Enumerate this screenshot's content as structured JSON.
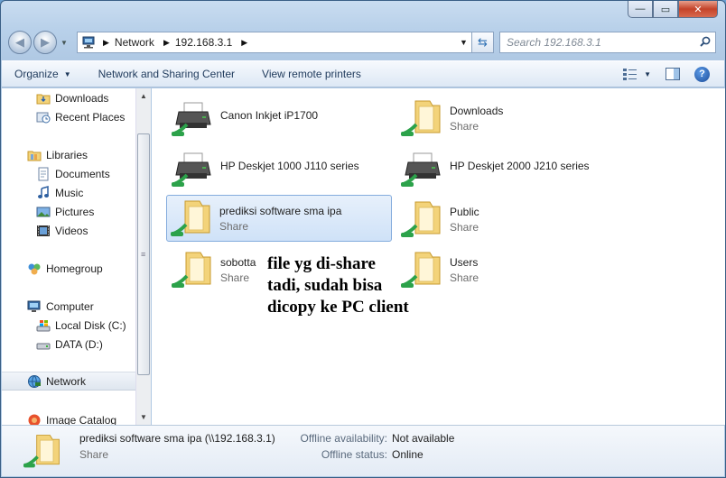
{
  "window": {
    "minimize_glyph": "—",
    "maximize_glyph": "▭",
    "close_glyph": "✕"
  },
  "nav": {
    "back_glyph": "◀",
    "forward_glyph": "▶",
    "dropdown_glyph": "▼",
    "breadcrumb": [
      "Network",
      "192.168.3.1"
    ],
    "search_placeholder": "Search 192.168.3.1"
  },
  "toolbar": {
    "organize": "Organize",
    "network_sharing": "Network and Sharing Center",
    "remote_printers": "View remote printers"
  },
  "sidebar": {
    "items": [
      {
        "label": "Downloads",
        "icon": "folder-icon"
      },
      {
        "label": "Recent Places",
        "icon": "recent-places-icon"
      },
      {
        "label": "Libraries",
        "icon": "libraries-icon"
      },
      {
        "label": "Documents",
        "icon": "documents-icon"
      },
      {
        "label": "Music",
        "icon": "music-icon"
      },
      {
        "label": "Pictures",
        "icon": "pictures-icon"
      },
      {
        "label": "Videos",
        "icon": "videos-icon"
      },
      {
        "label": "Homegroup",
        "icon": "homegroup-icon"
      },
      {
        "label": "Computer",
        "icon": "computer-icon"
      },
      {
        "label": "Local Disk (C:)",
        "icon": "local-disk-icon"
      },
      {
        "label": "DATA (D:)",
        "icon": "drive-icon"
      },
      {
        "label": "Network",
        "icon": "network-icon"
      },
      {
        "label": "Image Catalog",
        "icon": "image-catalog-icon"
      }
    ]
  },
  "items": [
    {
      "name": "Canon Inkjet iP1700",
      "sub": "",
      "type": "printer"
    },
    {
      "name": "Downloads",
      "sub": "Share",
      "type": "folder"
    },
    {
      "name": "HP Deskjet 1000 J110 series",
      "sub": "",
      "type": "printer"
    },
    {
      "name": "HP Deskjet 2000 J210 series",
      "sub": "",
      "type": "printer"
    },
    {
      "name": "prediksi software sma ipa",
      "sub": "Share",
      "type": "folder"
    },
    {
      "name": "Public",
      "sub": "Share",
      "type": "folder"
    },
    {
      "name": "sobotta",
      "sub": "Share",
      "type": "folder"
    },
    {
      "name": "Users",
      "sub": "Share",
      "type": "folder"
    }
  ],
  "annotation": "file yg di-share tadi, sudah bisa dicopy ke PC client",
  "details": {
    "title": "prediksi software sma ipa (\\\\192.168.3.1)",
    "type": "Share",
    "offline_availability_label": "Offline availability:",
    "offline_availability_value": "Not available",
    "offline_status_label": "Offline status:",
    "offline_status_value": "Online"
  },
  "colors": {
    "selection": "#cfe2f8",
    "folder": "#f3d37a",
    "pipe": "#2ca24a",
    "accent": "#1e395b"
  }
}
